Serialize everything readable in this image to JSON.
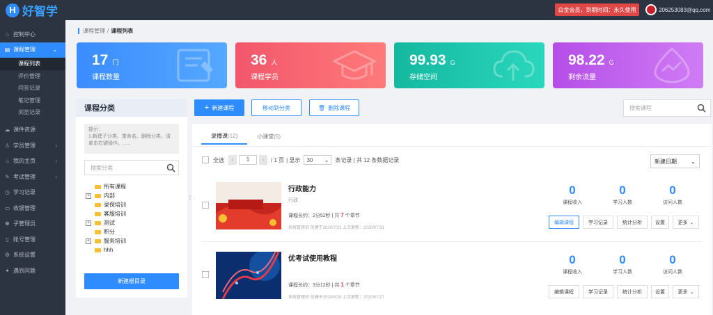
{
  "app": {
    "logo_letter": "H",
    "name": "好智学"
  },
  "header": {
    "vip_text": "白金会员，到期时间：永久使用",
    "email": "206253083@qq.com"
  },
  "sidebar": {
    "items": [
      {
        "label": "控制中心",
        "icon": "home-icon"
      },
      {
        "label": "课程管理",
        "icon": "book-icon",
        "active": true
      },
      {
        "label": "课件资源",
        "icon": "cloud-icon"
      },
      {
        "label": "学员管理",
        "icon": "user-icon"
      },
      {
        "label": "我的主页",
        "icon": "house-icon"
      },
      {
        "label": "考试管理",
        "icon": "exam-icon"
      },
      {
        "label": "学习记录",
        "icon": "record-icon"
      },
      {
        "label": "收银管理",
        "icon": "cashier-icon"
      },
      {
        "label": "子管理员",
        "icon": "admin-icon"
      },
      {
        "label": "账号管理",
        "icon": "account-icon"
      },
      {
        "label": "系统设置",
        "icon": "settings-icon"
      },
      {
        "label": "遇到问题",
        "icon": "help-icon"
      }
    ],
    "subitems": [
      "课程列表",
      "评价管理",
      "问答记录",
      "笔记管理",
      "浏览记录"
    ]
  },
  "breadcrumb": {
    "parent": "课程管理",
    "sep": "/",
    "current": "课程列表"
  },
  "cards": [
    {
      "value": "17",
      "unit": "门",
      "label": "课程数量",
      "color": "#3b8cff"
    },
    {
      "value": "36",
      "unit": "人",
      "label": "课程学员",
      "color": "#f2566b"
    },
    {
      "value": "99.93",
      "unit": "G",
      "label": "存储空间",
      "color": "#17c3a7"
    },
    {
      "value": "98.22",
      "unit": "G",
      "label": "剩余流量",
      "color": "#b54ee8"
    }
  ],
  "category": {
    "title": "课程分类",
    "tip": "提示：\n1.新建子分类、重命名、删除分类，请单击右键操作。......",
    "search_placeholder": "搜索分类",
    "tree": [
      {
        "label": "所有课程",
        "expand": ""
      },
      {
        "label": "内部",
        "expand": "+"
      },
      {
        "label": "录保培训",
        "expand": ""
      },
      {
        "label": "客服培训",
        "expand": ""
      },
      {
        "label": "测试",
        "expand": "+"
      },
      {
        "label": "积分",
        "expand": ""
      },
      {
        "label": "服务培训",
        "expand": "+"
      },
      {
        "label": "hhh",
        "expand": ""
      }
    ],
    "new_root": "新建根目录"
  },
  "toolbar": {
    "new_course": "新建课程",
    "move": "移动到分类",
    "delete": "删除课程",
    "search_placeholder": "搜索课程"
  },
  "tabs": [
    {
      "label": "录播课",
      "count": "(12)"
    },
    {
      "label": "小课堂",
      "count": "(5)"
    }
  ],
  "pager": {
    "select_all": "全选",
    "page": "1",
    "pages": "/ 1 页",
    "show": "| 显示",
    "per_page": "30",
    "records": "条记录 | 共 12 条数据记录",
    "sort": "新建日期"
  },
  "courses": [
    {
      "title": "行政能力",
      "subtitle": "行政",
      "duration": "课程长约：2分52秒",
      "chapters_pre": "| 共",
      "chapters": "7",
      "chapters_post": "个章节",
      "meta": "系统管理员 创建于2020/7/23 上次更新：2020/07/31",
      "income": "0",
      "students": "0",
      "visitors": "0"
    },
    {
      "title": "优考试使用教程",
      "subtitle": "",
      "duration": "课程长约：3分12秒",
      "chapters_pre": "| 共",
      "chapters": "1",
      "chapters_post": "个章节",
      "meta": "系统管理员 创建于2020/6/29 上次更新：2020/07/27",
      "income": "0",
      "students": "0",
      "visitors": "0"
    }
  ],
  "stat_labels": {
    "income": "课程收入",
    "students": "学习人数",
    "visitors": "访问人数"
  },
  "actions": {
    "edit": "编辑课程",
    "record": "学习记录",
    "analysis": "统计分析",
    "settings": "设置",
    "more": "更多"
  }
}
